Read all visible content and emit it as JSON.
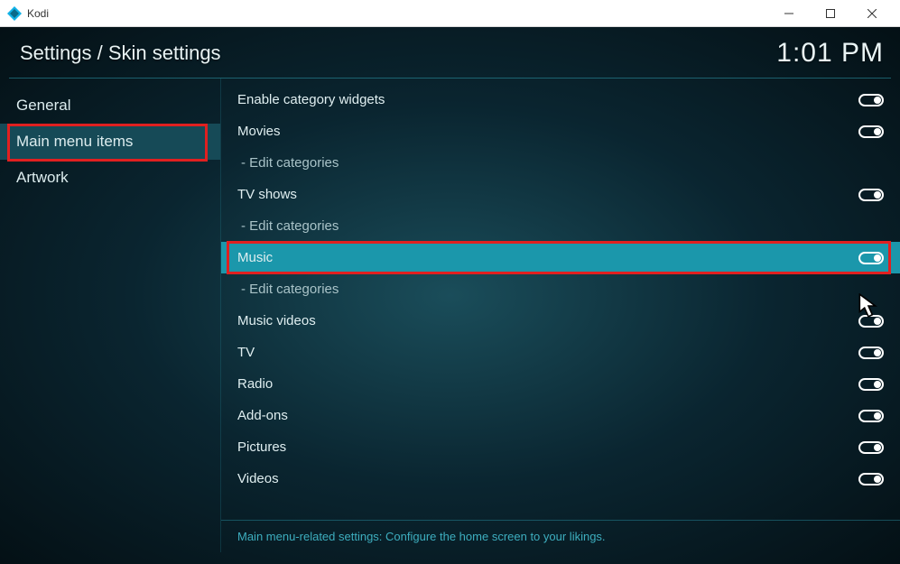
{
  "window": {
    "title": "Kodi"
  },
  "header": {
    "breadcrumb": "Settings / Skin settings",
    "clock": "1:01 PM"
  },
  "sidebar": {
    "items": [
      {
        "label": "General",
        "active": false
      },
      {
        "label": "Main menu items",
        "active": true
      },
      {
        "label": "Artwork",
        "active": false
      }
    ]
  },
  "settings": [
    {
      "label": "Enable category widgets",
      "toggle": "on",
      "sub": false,
      "highlighted": false
    },
    {
      "label": "Movies",
      "toggle": "on",
      "sub": false,
      "highlighted": false
    },
    {
      "label": "- Edit categories",
      "toggle": null,
      "sub": true,
      "highlighted": false
    },
    {
      "label": "TV shows",
      "toggle": "on",
      "sub": false,
      "highlighted": false
    },
    {
      "label": "- Edit categories",
      "toggle": null,
      "sub": true,
      "highlighted": false
    },
    {
      "label": "Music",
      "toggle": "on",
      "sub": false,
      "highlighted": true
    },
    {
      "label": "- Edit categories",
      "toggle": null,
      "sub": true,
      "highlighted": false
    },
    {
      "label": "Music videos",
      "toggle": "on",
      "sub": false,
      "highlighted": false
    },
    {
      "label": "TV",
      "toggle": "on",
      "sub": false,
      "highlighted": false
    },
    {
      "label": "Radio",
      "toggle": "on",
      "sub": false,
      "highlighted": false
    },
    {
      "label": "Add-ons",
      "toggle": "on",
      "sub": false,
      "highlighted": false
    },
    {
      "label": "Pictures",
      "toggle": "on",
      "sub": false,
      "highlighted": false
    },
    {
      "label": "Videos",
      "toggle": "on",
      "sub": false,
      "highlighted": false
    }
  ],
  "footer": {
    "help_text": "Main menu-related settings: Configure the home screen to your likings."
  }
}
